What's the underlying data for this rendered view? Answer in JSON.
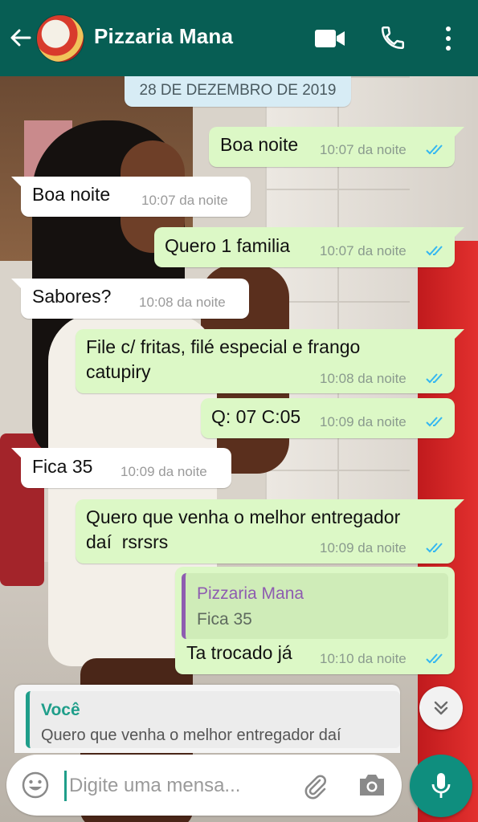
{
  "header": {
    "title": "Pizzaria Mana"
  },
  "date_chip": "28 DE DEZEMBRO DE 2019",
  "messages": [
    {
      "direction": "out",
      "text": "Boa noite",
      "time": "10:07 da noite"
    },
    {
      "direction": "in",
      "text": "Boa noite",
      "time": "10:07 da noite"
    },
    {
      "direction": "out",
      "text": "Quero 1 familia",
      "time": "10:07 da noite"
    },
    {
      "direction": "in",
      "text": "Sabores?",
      "time": "10:08 da noite"
    },
    {
      "direction": "out",
      "text": "File c/ fritas, filé especial e frango\ncatupiry",
      "time": "10:08 da noite"
    },
    {
      "direction": "out",
      "text": "Q: 07 C:05",
      "time": "10:09 da noite"
    },
    {
      "direction": "in",
      "text": "Fica 35",
      "time": "10:09 da noite"
    },
    {
      "direction": "out",
      "text": "Quero que venha o melhor entregador\ndaí  rsrsrs",
      "time": "10:09 da noite"
    },
    {
      "direction": "out",
      "quote": {
        "name": "Pizzaria Mana",
        "text": "Fica 35"
      },
      "text": "Ta trocado já",
      "time": "10:10 da noite"
    }
  ],
  "reply_preview": {
    "name": "Você",
    "text": "Quero que venha o melhor entregador daí"
  },
  "composer": {
    "placeholder": "Digite uma mensa..."
  },
  "colors": {
    "header": "#075e54",
    "outgoing_bubble": "#dcf8c6",
    "incoming_bubble": "#ffffff",
    "read_ticks": "#34b7f1",
    "quote_author": "#8e5cb0",
    "reply_author": "#1f9e8a",
    "mic_button": "#0f8e7e"
  },
  "icons": {
    "back": "back-arrow-icon",
    "video": "video-call-icon",
    "call": "phone-icon",
    "menu": "more-vertical-icon",
    "scroll": "double-chevron-down-icon",
    "emoji": "emoji-icon",
    "attach": "paperclip-icon",
    "camera": "camera-icon",
    "mic": "microphone-icon"
  }
}
